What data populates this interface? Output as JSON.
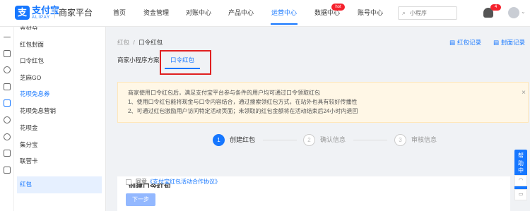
{
  "header": {
    "logo_glyph": "支",
    "brand_name": "支付宝",
    "brand_sub": "ALIPAY",
    "platform_name": "商家平台",
    "nav": [
      {
        "label": "首页"
      },
      {
        "label": "资金管理"
      },
      {
        "label": "对账中心"
      },
      {
        "label": "产品中心"
      },
      {
        "label": "运营中心",
        "active": true
      },
      {
        "label": "数据中心",
        "badge": "hot"
      },
      {
        "label": "账号中心"
      }
    ],
    "search_placeholder": "小程序",
    "bell_badge": "4"
  },
  "sidebar": {
    "items": [
      "支付分",
      "红包封面",
      "口令红包",
      "芝麻GO",
      "花呗免息券",
      "花呗免息营销",
      "花呗金",
      "集分宝",
      "联营卡"
    ],
    "selected_label": "红包"
  },
  "main": {
    "breadcrumb_root": "红包",
    "breadcrumb_sep": "/",
    "breadcrumb_current": "口令红包",
    "links": {
      "records": "红包记录",
      "cover_records": "封面记录"
    },
    "tabs": [
      "商家小程序方案",
      "口令红包"
    ],
    "notice": [
      "商家使用口令红包后，满足支付宝平台参与条件的用户均可通过口令领取红包",
      "1、使用口令红包能将现金与口令内容结合，通过搜索领红包方式，在站外也具有较好传播性",
      "2、可通过红包激励用户访问特定活动页面；未领取的红包金额将在活动结束后24小时内退回"
    ],
    "steps": [
      {
        "num": "1",
        "label": "创建红包",
        "active": true
      },
      {
        "num": "2",
        "label": "确认信息",
        "active": false
      },
      {
        "num": "3",
        "label": "审核信息",
        "active": false
      }
    ],
    "form": {
      "title": "创建口令红包",
      "agree_prefix": "同意",
      "agree_link": "《支付宝红包活动合作协议》",
      "next_label": "下一步"
    }
  },
  "help": {
    "label": "帮助中心"
  }
}
